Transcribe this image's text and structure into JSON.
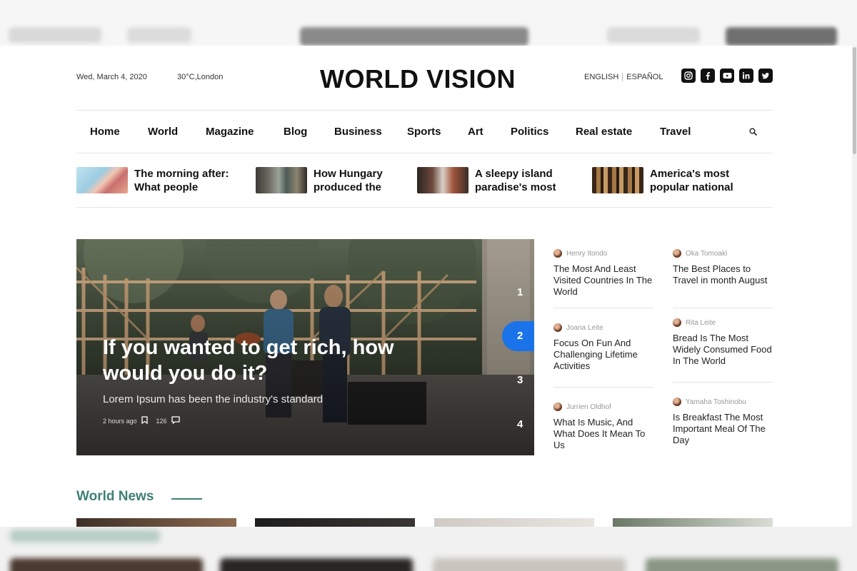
{
  "header": {
    "date": "Wed, March 4, 2020",
    "weather": "30°C,London",
    "logo": "WORLD VISION",
    "languages": [
      "ENGLISH",
      "ESPAÑOL"
    ],
    "socials": [
      "instagram-icon",
      "facebook-icon",
      "youtube-icon",
      "linkedin-icon",
      "twitter-icon"
    ]
  },
  "nav": {
    "items": [
      "Home",
      "World",
      "Magazine",
      "Blog",
      "Business",
      "Sports",
      "Art",
      "Politics",
      "Real estate",
      "Travel"
    ],
    "search_icon": "search-icon"
  },
  "trending": [
    {
      "title": "The morning after: What people"
    },
    {
      "title": "How Hungary produced the"
    },
    {
      "title": "A sleepy island paradise's most"
    },
    {
      "title": "America's most popular national"
    }
  ],
  "hero": {
    "title": "If you wanted to get rich, how would you do it?",
    "subtitle": "Lorem Ipsum has been the industry's standard",
    "time": "2 hours ago",
    "comments": "126",
    "slides": [
      "1",
      "2",
      "3",
      "4"
    ],
    "active_slide": "2",
    "accent": "#1a73e8"
  },
  "side_articles": {
    "left": [
      {
        "author": "Henry Itondo",
        "title": "The Most And Least Visited Countries In The World"
      },
      {
        "author": "Joana Leite",
        "title": "Focus On Fun And Challenging Lifetime Activities"
      },
      {
        "author": "Jurrien Oldhof",
        "title": "What Is Music, And What Does It Mean To Us"
      }
    ],
    "right": [
      {
        "author": "Oka Tomoaki",
        "title": "The Best Places to Travel in month August"
      },
      {
        "author": "Rita Leite",
        "title": "Bread Is The Most Widely Consumed Food In The World"
      },
      {
        "author": "Yamaha Toshinobu",
        "title": "Is Breakfast The Most Important Meal Of The Day"
      }
    ]
  },
  "world_news": {
    "title": "World News",
    "accent": "#3f7f74"
  }
}
